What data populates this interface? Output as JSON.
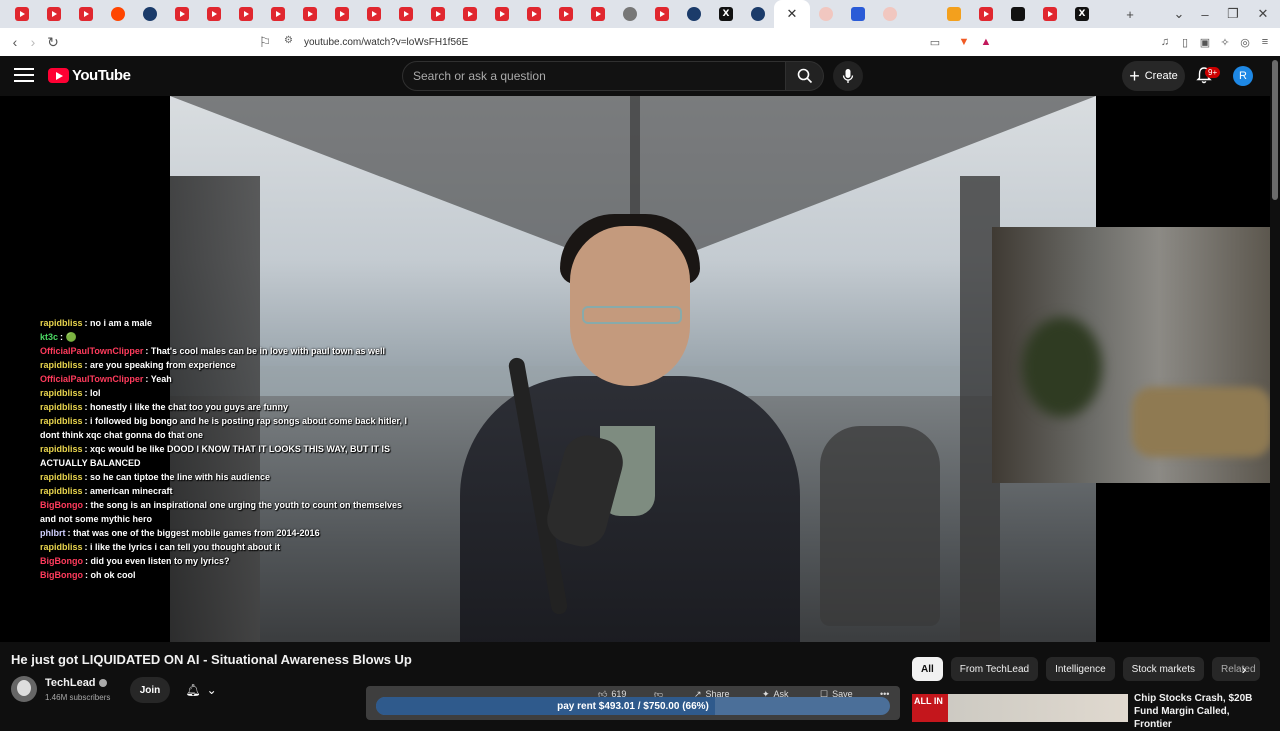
{
  "browser": {
    "tabs": [
      "youtube",
      "youtube",
      "youtube",
      "reddit",
      "steam",
      "youtube",
      "youtube",
      "youtube",
      "youtube",
      "youtube",
      "youtube",
      "youtube",
      "youtube",
      "youtube",
      "youtube",
      "youtube",
      "youtube",
      "youtube",
      "youtube",
      "generic",
      "youtube",
      "steam",
      "x",
      "steam",
      "active",
      "pink",
      "blue",
      "pink",
      "blank",
      "orange",
      "youtube",
      "media",
      "youtube",
      "x"
    ],
    "close_glyph": "✕",
    "new_tab_glyph": "+",
    "url": "youtube.com/watch?v=loWsFH1f56E"
  },
  "youtube": {
    "logo_text": "YouTube",
    "search_placeholder": "Search or ask a question",
    "create_label": "Create",
    "notification_count": "9+",
    "avatar_letter": "R"
  },
  "chat": [
    {
      "user": "rapidbliss",
      "color": "#e8d44d",
      "text": "no i am a male"
    },
    {
      "user": "kt3c",
      "color": "#4cd964",
      "text": "🟢"
    },
    {
      "user": "OfficialPaulTownClipper",
      "color": "#ff3b5c",
      "text": "That's cool males can be in love with paul town as well"
    },
    {
      "user": "rapidbliss",
      "color": "#e8d44d",
      "text": "are you speaking from experience"
    },
    {
      "user": "OfficialPaulTownClipper",
      "color": "#ff3b5c",
      "text": "Yeah"
    },
    {
      "user": "rapidbliss",
      "color": "#e8d44d",
      "text": "lol"
    },
    {
      "user": "rapidbliss",
      "color": "#e8d44d",
      "text": "honestly i like the chat too you guys are funny"
    },
    {
      "user": "rapidbliss",
      "color": "#e8d44d",
      "text": "i followed big bongo and he is posting rap songs about come back hitler, I dont think xqc chat gonna do that one"
    },
    {
      "user": "rapidbliss",
      "color": "#e8d44d",
      "text": "xqc would be like DOOD I KNOW THAT IT LOOKS THIS WAY, BUT IT IS ACTUALLY BALANCED"
    },
    {
      "user": "rapidbliss",
      "color": "#e8d44d",
      "text": "so he can tiptoe the line with his audience"
    },
    {
      "user": "rapidbliss",
      "color": "#e8d44d",
      "text": "american minecraft"
    },
    {
      "user": "BigBongo",
      "color": "#ff3b5c",
      "text": "the song is an inspirational one urging the youth to count on themselves and not some mythic hero"
    },
    {
      "user": "phlbrt",
      "color": "#d0d0ff",
      "text": "that was one of the biggest mobile games from 2014-2016"
    },
    {
      "user": "rapidbliss",
      "color": "#e8d44d",
      "text": "i like the lyrics i can tell you thought about it"
    },
    {
      "user": "BigBongo",
      "color": "#ff3b5c",
      "text": "did you even listen to my lyrics?"
    },
    {
      "user": "BigBongo",
      "color": "#ff3b5c",
      "text": "oh ok cool"
    }
  ],
  "video": {
    "title": "He just got LIQUIDATED ON AI - Situational Awareness Blows Up",
    "channel": "TechLead",
    "subscribers": "1.46M subscribers",
    "join_label": "Join",
    "like_count": "619",
    "share_label": "Share",
    "ask_label": "Ask",
    "save_label": "Save",
    "more_label": "•••"
  },
  "progress": {
    "label": "pay rent $493.01 / $750.00 (66%)",
    "fraction": 0.66
  },
  "chips": [
    "All",
    "From TechLead",
    "Intelligence",
    "Stock markets",
    "Related"
  ],
  "recommendation": {
    "thumb_text": "ALL IN",
    "title": "Chip Stocks Crash, $20B Fund Margin Called, Frontier"
  }
}
